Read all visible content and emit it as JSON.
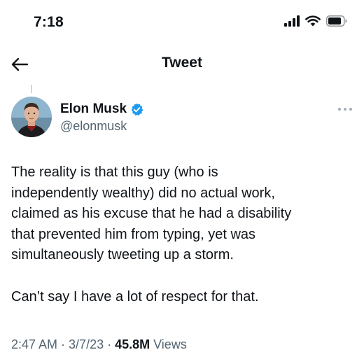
{
  "status_bar": {
    "time": "7:18",
    "icons": [
      "cellular-signal-icon",
      "wifi-icon",
      "battery-icon"
    ]
  },
  "nav": {
    "back_icon": "back-arrow-icon",
    "title": "Tweet"
  },
  "tweet": {
    "author": {
      "name": "Elon Musk",
      "handle": "@elonmusk",
      "verified": true,
      "verified_color": "#1d9bf0"
    },
    "paragraphs": [
      "The reality is that this guy (who is\nindependently wealthy) did no actual work,\nclaimed as his excuse that he had a disability\nthat prevented him from typing, yet was\nsimultaneously tweeting up a storm.",
      "Can’t say I have a lot of respect for that."
    ],
    "meta": {
      "time": "2:47 AM",
      "separator": " · ",
      "date": "3/7/23",
      "views_count": "45.8M",
      "views_label": " Views"
    }
  },
  "colors": {
    "text": "#0f1419",
    "secondary_text": "#536471",
    "accent": "#1d9bf0"
  }
}
